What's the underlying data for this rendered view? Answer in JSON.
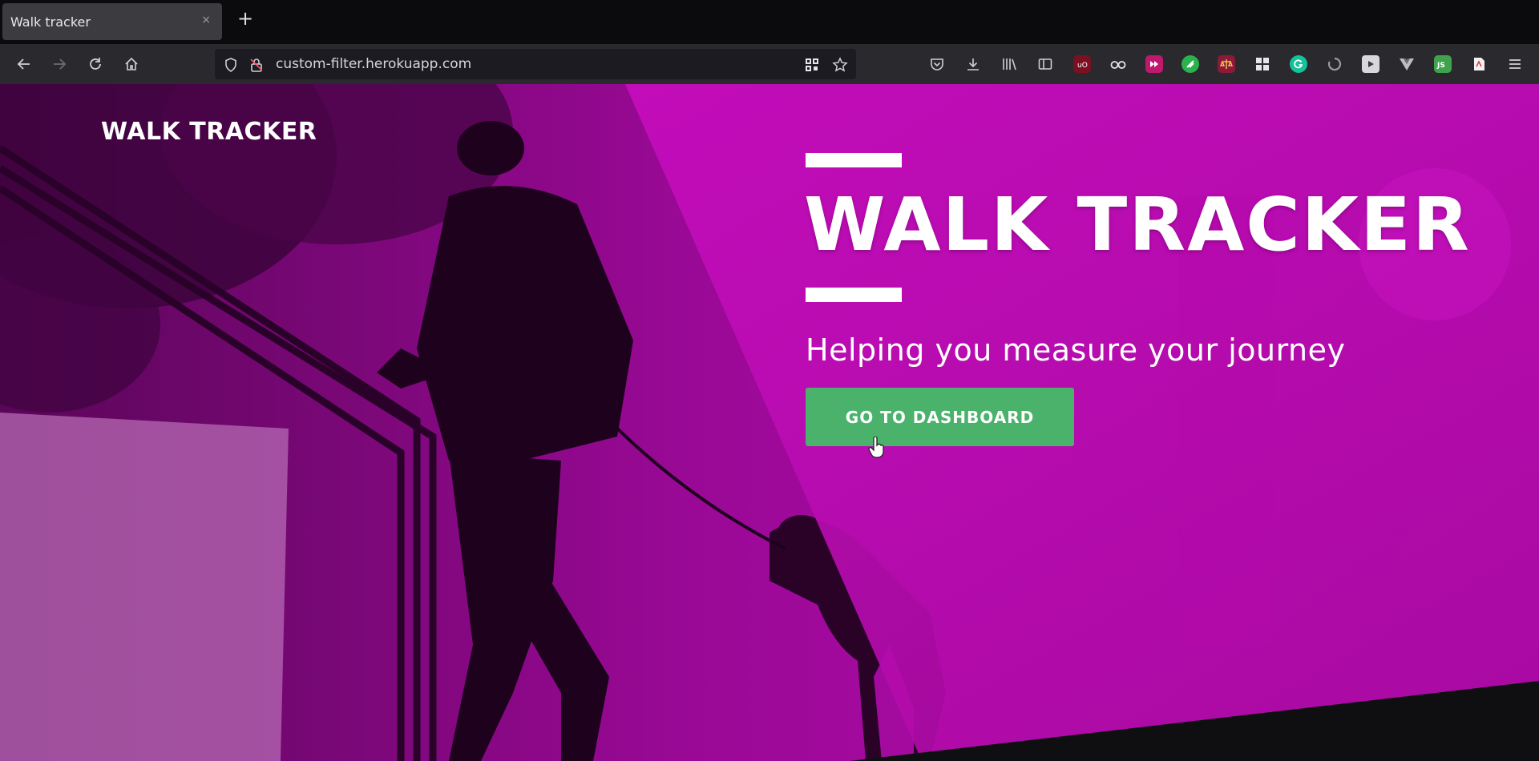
{
  "browser": {
    "tab_title": "Walk tracker",
    "tab_close": "×",
    "new_tab": "+",
    "url": "custom-filter.herokuapp.com",
    "nav_icons": [
      "back-icon",
      "forward-icon",
      "reload-icon",
      "home-icon"
    ],
    "url_icons": [
      "shield-icon",
      "site-lock-icon",
      "qr-code-icon",
      "bookmark-star-icon"
    ],
    "extensions": [
      "pocket-icon",
      "downloads-icon",
      "library-icon",
      "sidebar-icon",
      "ublock-origin-icon",
      "glasses-icon",
      "fast-forward-icon",
      "feedly-icon",
      "scales-icon",
      "apps-grid-icon",
      "grammarly-icon",
      "spinner-icon",
      "video-player-icon",
      "vuejs-icon",
      "js-badge-icon",
      "pdf-icon",
      "menu-icon"
    ]
  },
  "site": {
    "logo": "WALK TRACKER",
    "hero_title": "WALK TRACKER",
    "hero_subtitle": "Helping you measure your journey",
    "cta_label": "GO TO DASHBOARD"
  },
  "colors": {
    "hero_magenta": "#b10aa8",
    "cta_green": "#4bb26c",
    "chrome_dark": "#0b0b0d",
    "toolbar": "#2a2a2e"
  }
}
